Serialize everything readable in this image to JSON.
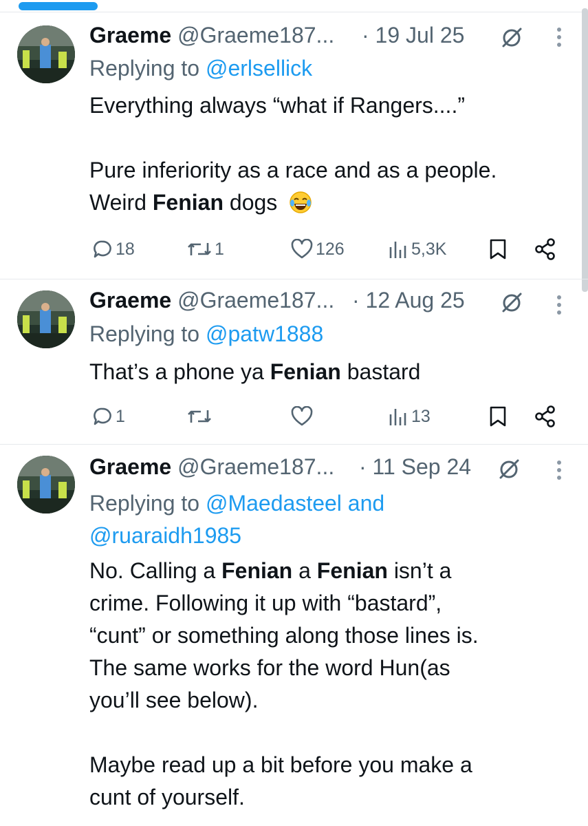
{
  "tweets": [
    {
      "name": "Graeme",
      "handle": "@Graeme187...",
      "dot": "·",
      "date": "19 Jul 25",
      "replying_prefix": "Replying to",
      "replying_to": [
        "@erlsellick"
      ],
      "body": {
        "l1": "Everything always “what if Rangers....”",
        "l2": "Pure inferiority as a race and as a people.",
        "l3a": "Weird ",
        "l3b": "Fenian",
        "l3c": " dogs",
        "emoji": "face-with-tears-of-joy"
      },
      "stats": {
        "replies": "18",
        "reposts": "1",
        "likes": "126",
        "views": "5,3K"
      }
    },
    {
      "name": "Graeme",
      "handle": "@Graeme187...",
      "dot": "·",
      "date": "12 Aug 25",
      "replying_prefix": "Replying to",
      "replying_to": [
        "@patw1888"
      ],
      "body": {
        "l1a": "That’s a phone ya ",
        "l1b": "Fenian",
        "l1c": " bastard"
      },
      "stats": {
        "replies": "1",
        "reposts": "",
        "likes": "",
        "views": "13"
      }
    },
    {
      "name": "Graeme",
      "handle": "@Graeme187...",
      "dot": "·",
      "date": "11 Sep 24",
      "replying_prefix": "Replying to",
      "replying_to": [
        "@Maedasteel",
        "@ruaraidh1985"
      ],
      "replying_joiner": "and",
      "body": {
        "l1a": "No. Calling a ",
        "l1b": "Fenian",
        "l1c": " a ",
        "l1d": "Fenian",
        "l1e": " isn’t a",
        "l2": "crime. Following it up with “bastard”,",
        "l3": "“cunt” or something along those lines is.",
        "l4": "The same works for the word Hun(as",
        "l5": "you’ll see below).",
        "l6": "Maybe read up a bit before you make a",
        "l7": "cunt of yourself."
      }
    }
  ],
  "colors": {
    "accent": "#1d9bf0",
    "muted": "#536471",
    "text": "#0f1419"
  }
}
